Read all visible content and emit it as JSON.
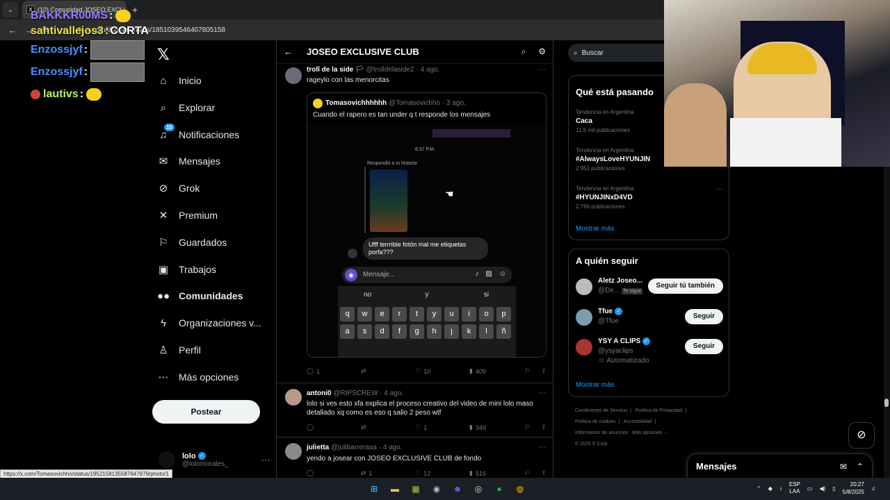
{
  "browser": {
    "tab_title": "(10) Comunidad JOSEO EXCLUSIVE",
    "url": "x.com/i/communities/1851039546407805158",
    "status_url": "https://x.com/Tomasovichho/status/1952158135587647979/photo/1"
  },
  "chat": [
    {
      "user": "BAKKKR00MS",
      "msg": ""
    },
    {
      "user": "santivallejos3",
      "msg": "CORTA"
    },
    {
      "user": "Enzossjyf",
      "msg": ""
    },
    {
      "user": "Enzossjyf",
      "msg": ""
    },
    {
      "user": "lautivs",
      "msg": ""
    }
  ],
  "nav": {
    "items": [
      {
        "label": "Inicio",
        "icon": "home-icon"
      },
      {
        "label": "Explorar",
        "icon": "search-icon"
      },
      {
        "label": "Notificaciones",
        "icon": "bell-icon",
        "badge": "10"
      },
      {
        "label": "Mensajes",
        "icon": "mail-icon"
      },
      {
        "label": "Grok",
        "icon": "grok-icon"
      },
      {
        "label": "Premium",
        "icon": "x-logo-icon"
      },
      {
        "label": "Guardados",
        "icon": "bookmark-icon"
      },
      {
        "label": "Trabajos",
        "icon": "briefcase-icon"
      },
      {
        "label": "Comunidades",
        "icon": "people-icon"
      },
      {
        "label": "Organizaciones v...",
        "icon": "lightning-icon"
      },
      {
        "label": "Perfil",
        "icon": "person-icon"
      },
      {
        "label": "Más opciones",
        "icon": "more-circle-icon"
      }
    ],
    "post_button": "Postear",
    "me_name": "lolo",
    "me_handle": "@lolomorales_"
  },
  "main": {
    "title": "JOSEO EXCLUSIVE CLUB",
    "posts": [
      {
        "name": "troll de la side",
        "handle": "@trolldelaside2 · 4 ago.",
        "text": "rageylo con las menorcitas",
        "replies": "1",
        "reposts": "",
        "likes": "10",
        "views": "409",
        "quote": {
          "name": "Tomasovichhhhhh",
          "handle": "@Tomasovichho · 3 ago.",
          "text": "Cuando el rapero es tan under q t responde los mensajes",
          "dm_time": "8:37 P.M.",
          "dm_reply": "Respondió a tu historia",
          "dm_bubble": "Ufff terrrible fotón mal me etiquetas porfa???",
          "dm_placeholder": "Mensaje...",
          "suggestions": [
            "no",
            "y",
            "si"
          ],
          "row1": [
            "q",
            "w",
            "e",
            "r",
            "t",
            "y",
            "u",
            "i",
            "o",
            "p"
          ],
          "row2": [
            "a",
            "s",
            "d",
            "f",
            "g",
            "h",
            "j",
            "k",
            "l",
            "ñ"
          ]
        }
      },
      {
        "name": "antoni0",
        "handle": "@RIPSCREW · 4 ago.",
        "text": "lolo si ves esto xfa explica el proceso creativo del video de mini lolo maso detallado xq como es eso q salio 2 peso wtf",
        "replies": "",
        "reposts": "",
        "likes": "1",
        "views": "349"
      },
      {
        "name": "julietta",
        "handle": "@julibarreraaa · 4 ago.",
        "text": "yendo a josear con JOSEO EXCLUSIVE CLUB de fondo",
        "replies": "",
        "reposts": "1",
        "likes": "12",
        "views": "516"
      }
    ]
  },
  "right": {
    "search_placeholder": "Buscar",
    "trends_title": "Qué está pasando",
    "trends": [
      {
        "ctx": "Tendencia en Argentina",
        "name": "Caca",
        "count": "11,9 mil publicaciones"
      },
      {
        "ctx": "Tendencia en Argentina",
        "name": "#AlwaysLoveHYUNJIN",
        "count": "2.951 publicaciones"
      },
      {
        "ctx": "Tendencia en Argentina",
        "name": "#HYUNJINxD4VD",
        "count": "2.766 publicaciones"
      }
    ],
    "show_more": "Mostrar más",
    "follow_title": "A quién seguir",
    "follow": [
      {
        "name": "Aletz Joseo...",
        "handle": "@De...",
        "tag": "Te sigue",
        "button": "Seguir tú también",
        "auto": ""
      },
      {
        "name": "Tfue",
        "handle": "@Tfue",
        "tag": "",
        "button": "Seguir",
        "auto": ""
      },
      {
        "name": "YSY A CLIPS",
        "handle": "@ysyaclips",
        "tag": "",
        "button": "Seguir",
        "auto": "Automatizado"
      }
    ],
    "footer": [
      "Condiciones de Servicio",
      "|",
      "Política de Privacidad",
      "|",
      "Política de cookies",
      "|",
      "Accesibilidad",
      "|",
      "Información de anuncios",
      "Más opciones ···",
      "© 2025 X Corp."
    ],
    "messages_title": "Mensajes"
  },
  "tray": {
    "lang1": "ESP",
    "lang2": "LAA",
    "time": "20:27",
    "date": "5/8/2025"
  }
}
